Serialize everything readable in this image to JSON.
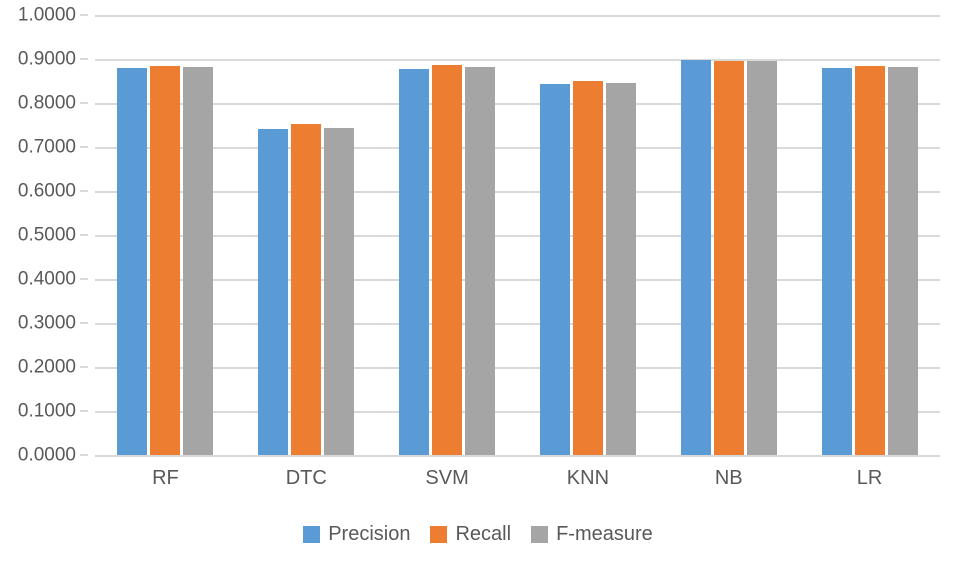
{
  "chart_data": {
    "type": "bar",
    "title": "",
    "subtitle": "",
    "xlabel": "",
    "ylabel": "",
    "categories": [
      "RF",
      "DTC",
      "SVM",
      "KNN",
      "NB",
      "LR"
    ],
    "series": [
      {
        "name": "Precision",
        "color": "#5B9BD5",
        "values": [
          0.879,
          0.741,
          0.878,
          0.843,
          0.898,
          0.879
        ]
      },
      {
        "name": "Recall",
        "color": "#ED7D31",
        "values": [
          0.884,
          0.752,
          0.886,
          0.85,
          0.895,
          0.885
        ]
      },
      {
        "name": "F-measure",
        "color": "#A5A5A5",
        "values": [
          0.881,
          0.744,
          0.881,
          0.845,
          0.895,
          0.881
        ]
      }
    ],
    "ylim": [
      0.0,
      1.0
    ],
    "ytick_values": [
      1.0,
      0.9,
      0.8,
      0.7,
      0.6,
      0.5,
      0.4,
      0.3,
      0.2,
      0.1,
      0.0
    ],
    "ytick_labels": [
      "1.0000",
      "0.9000",
      "0.8000",
      "0.7000",
      "0.6000",
      "0.5000",
      "0.4000",
      "0.3000",
      "0.2000",
      "0.1000",
      "0.0000"
    ],
    "grid": true,
    "grid_color": "#D9D9D9",
    "legend_position": "bottom",
    "axis_text_color": "#595959",
    "background_color": "#FFFFFF"
  }
}
